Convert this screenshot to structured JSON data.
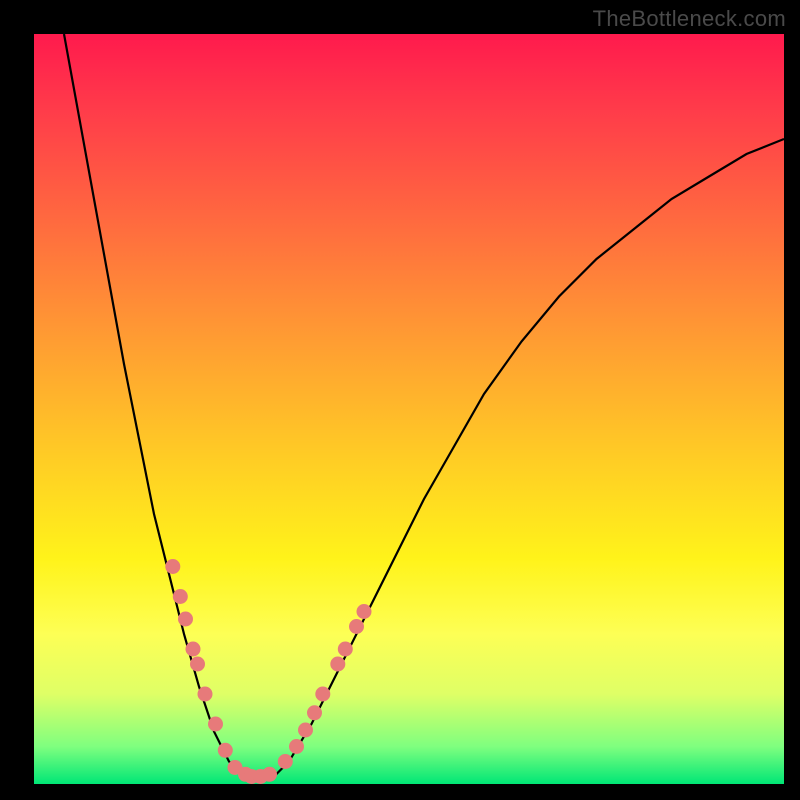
{
  "watermark": "TheBottleneck.com",
  "chart_data": {
    "type": "line",
    "title": "",
    "xlabel": "",
    "ylabel": "",
    "xlim": [
      0,
      100
    ],
    "ylim": [
      0,
      100
    ],
    "curve": {
      "name": "bottleneck-curve",
      "color": "#000000",
      "points": [
        {
          "x": 4,
          "y": 100
        },
        {
          "x": 6,
          "y": 89
        },
        {
          "x": 8,
          "y": 78
        },
        {
          "x": 10,
          "y": 67
        },
        {
          "x": 12,
          "y": 56
        },
        {
          "x": 14,
          "y": 46
        },
        {
          "x": 16,
          "y": 36
        },
        {
          "x": 18,
          "y": 28
        },
        {
          "x": 20,
          "y": 20
        },
        {
          "x": 22,
          "y": 13
        },
        {
          "x": 24,
          "y": 7
        },
        {
          "x": 26,
          "y": 3
        },
        {
          "x": 28,
          "y": 1
        },
        {
          "x": 30,
          "y": 0.6
        },
        {
          "x": 32,
          "y": 1
        },
        {
          "x": 34,
          "y": 3
        },
        {
          "x": 37,
          "y": 8
        },
        {
          "x": 40,
          "y": 14
        },
        {
          "x": 44,
          "y": 22
        },
        {
          "x": 48,
          "y": 30
        },
        {
          "x": 52,
          "y": 38
        },
        {
          "x": 56,
          "y": 45
        },
        {
          "x": 60,
          "y": 52
        },
        {
          "x": 65,
          "y": 59
        },
        {
          "x": 70,
          "y": 65
        },
        {
          "x": 75,
          "y": 70
        },
        {
          "x": 80,
          "y": 74
        },
        {
          "x": 85,
          "y": 78
        },
        {
          "x": 90,
          "y": 81
        },
        {
          "x": 95,
          "y": 84
        },
        {
          "x": 100,
          "y": 86
        }
      ]
    },
    "markers_left": {
      "color": "#e77a7a",
      "points": [
        {
          "x": 18.5,
          "y": 29
        },
        {
          "x": 19.5,
          "y": 25
        },
        {
          "x": 20.2,
          "y": 22
        },
        {
          "x": 21.2,
          "y": 18
        },
        {
          "x": 21.8,
          "y": 16
        },
        {
          "x": 22.8,
          "y": 12
        },
        {
          "x": 24.2,
          "y": 8
        },
        {
          "x": 25.5,
          "y": 4.5
        },
        {
          "x": 26.8,
          "y": 2.2
        },
        {
          "x": 28.2,
          "y": 1.3
        },
        {
          "x": 29.0,
          "y": 1.0
        },
        {
          "x": 30.2,
          "y": 1.0
        },
        {
          "x": 31.4,
          "y": 1.3
        }
      ]
    },
    "markers_right": {
      "color": "#e77a7a",
      "points": [
        {
          "x": 33.5,
          "y": 3.0
        },
        {
          "x": 35.0,
          "y": 5.0
        },
        {
          "x": 36.2,
          "y": 7.2
        },
        {
          "x": 37.4,
          "y": 9.5
        },
        {
          "x": 38.5,
          "y": 12.0
        },
        {
          "x": 40.5,
          "y": 16.0
        },
        {
          "x": 41.5,
          "y": 18.0
        },
        {
          "x": 43.0,
          "y": 21.0
        },
        {
          "x": 44.0,
          "y": 23.0
        }
      ]
    }
  }
}
